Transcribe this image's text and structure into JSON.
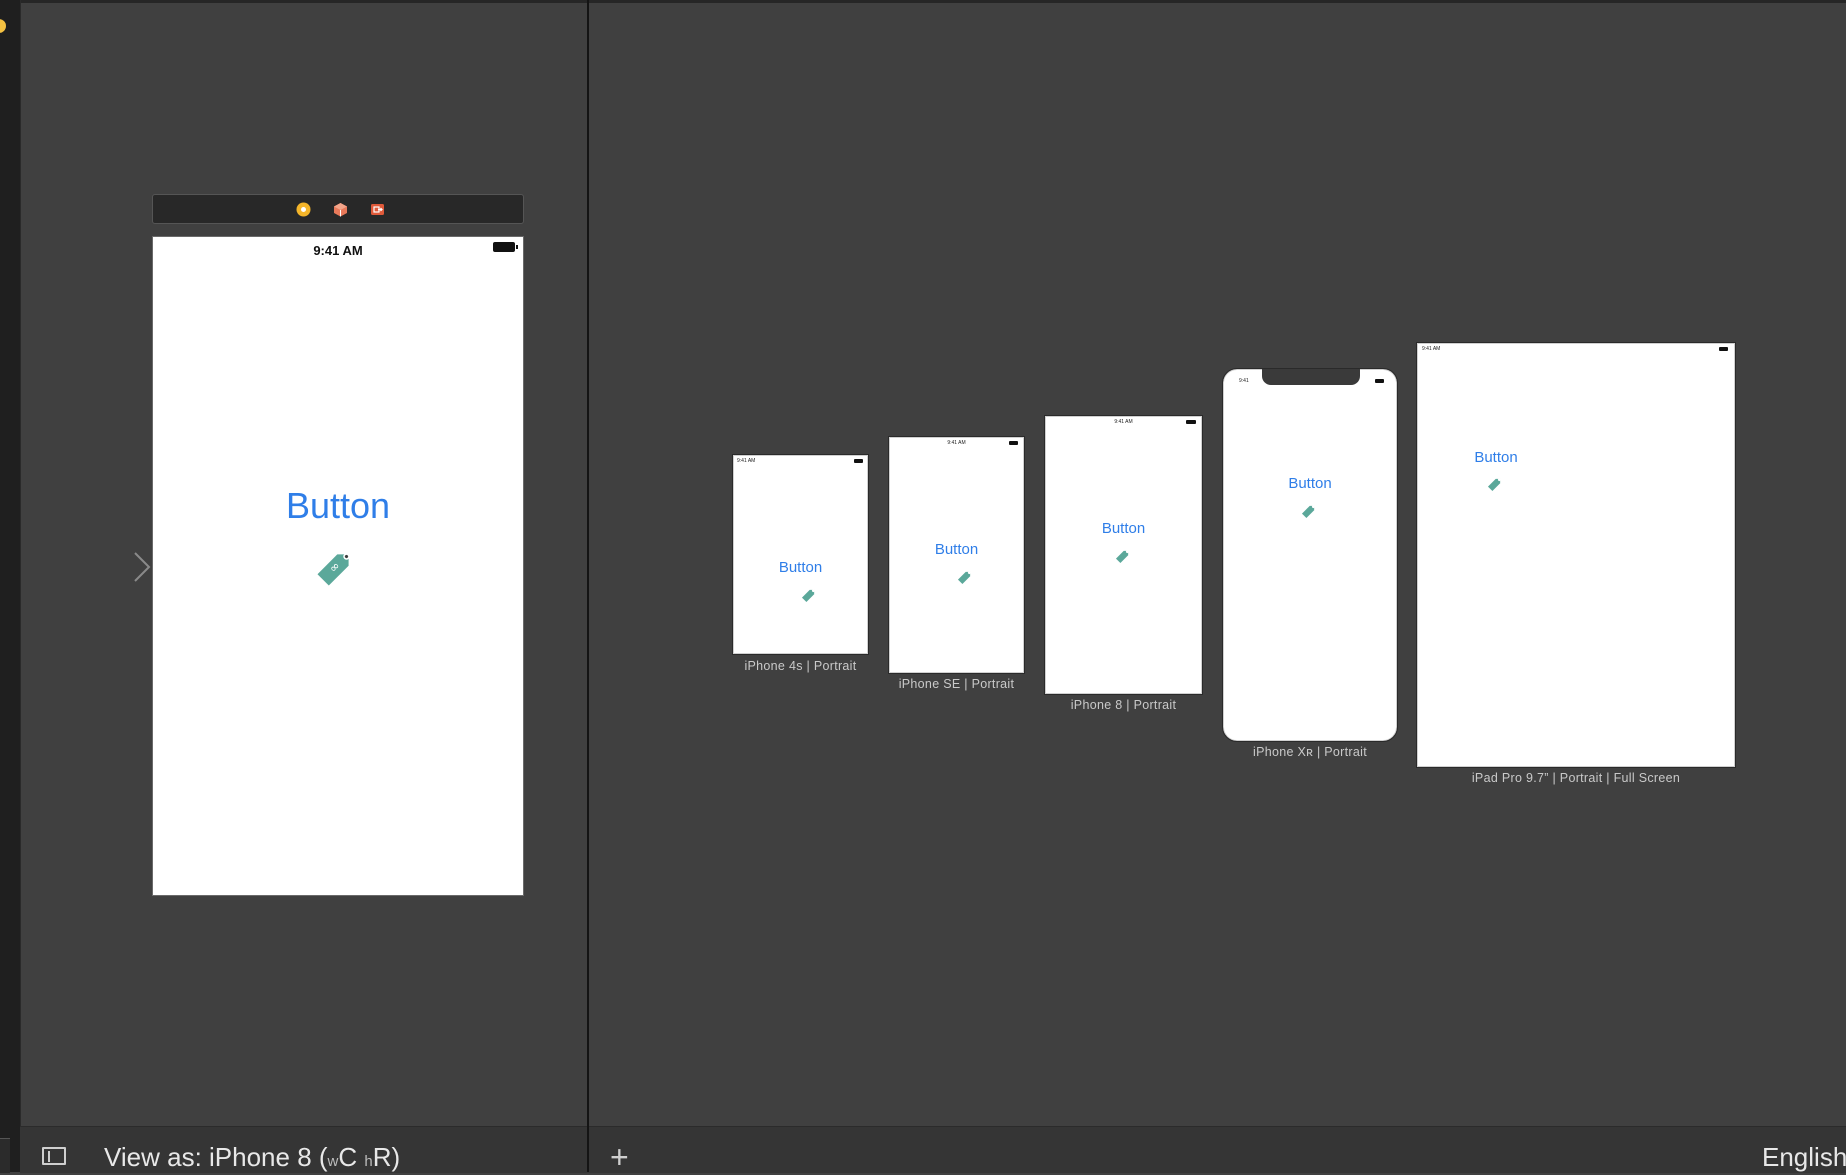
{
  "scene": {
    "status_time": "9:41 AM",
    "button_label": "Button"
  },
  "previews": [
    {
      "caption": "iPhone 4s | Portrait",
      "time": "9:41 AM",
      "button_label": "Button"
    },
    {
      "caption": "iPhone SE | Portrait",
      "time": "9:41 AM",
      "button_label": "Button"
    },
    {
      "caption": "iPhone 8 | Portrait",
      "time": "9:41 AM",
      "button_label": "Button"
    },
    {
      "caption": "iPhone Xʀ | Portrait",
      "time": "9:41",
      "button_label": "Button"
    },
    {
      "caption": "iPad Pro 9.7” | Portrait | Full Screen",
      "time": "9:41 AM",
      "button_label": "Button"
    }
  ],
  "bottom_bar": {
    "view_as_prefix": "View as: iPhone 8 (",
    "w_class": "w",
    "c_label": "C",
    "h_class": "h",
    "r_label": "R)",
    "language": "English"
  },
  "colors": {
    "canvas": "#404040",
    "button_blue": "#2f7ee8",
    "tag_green": "#5ba89a"
  },
  "icons": [
    "first-responder-icon",
    "object-cube-icon",
    "exit-icon",
    "tag-icon",
    "sidebar-toggle-icon",
    "plus-icon",
    "entry-arrow-icon"
  ]
}
